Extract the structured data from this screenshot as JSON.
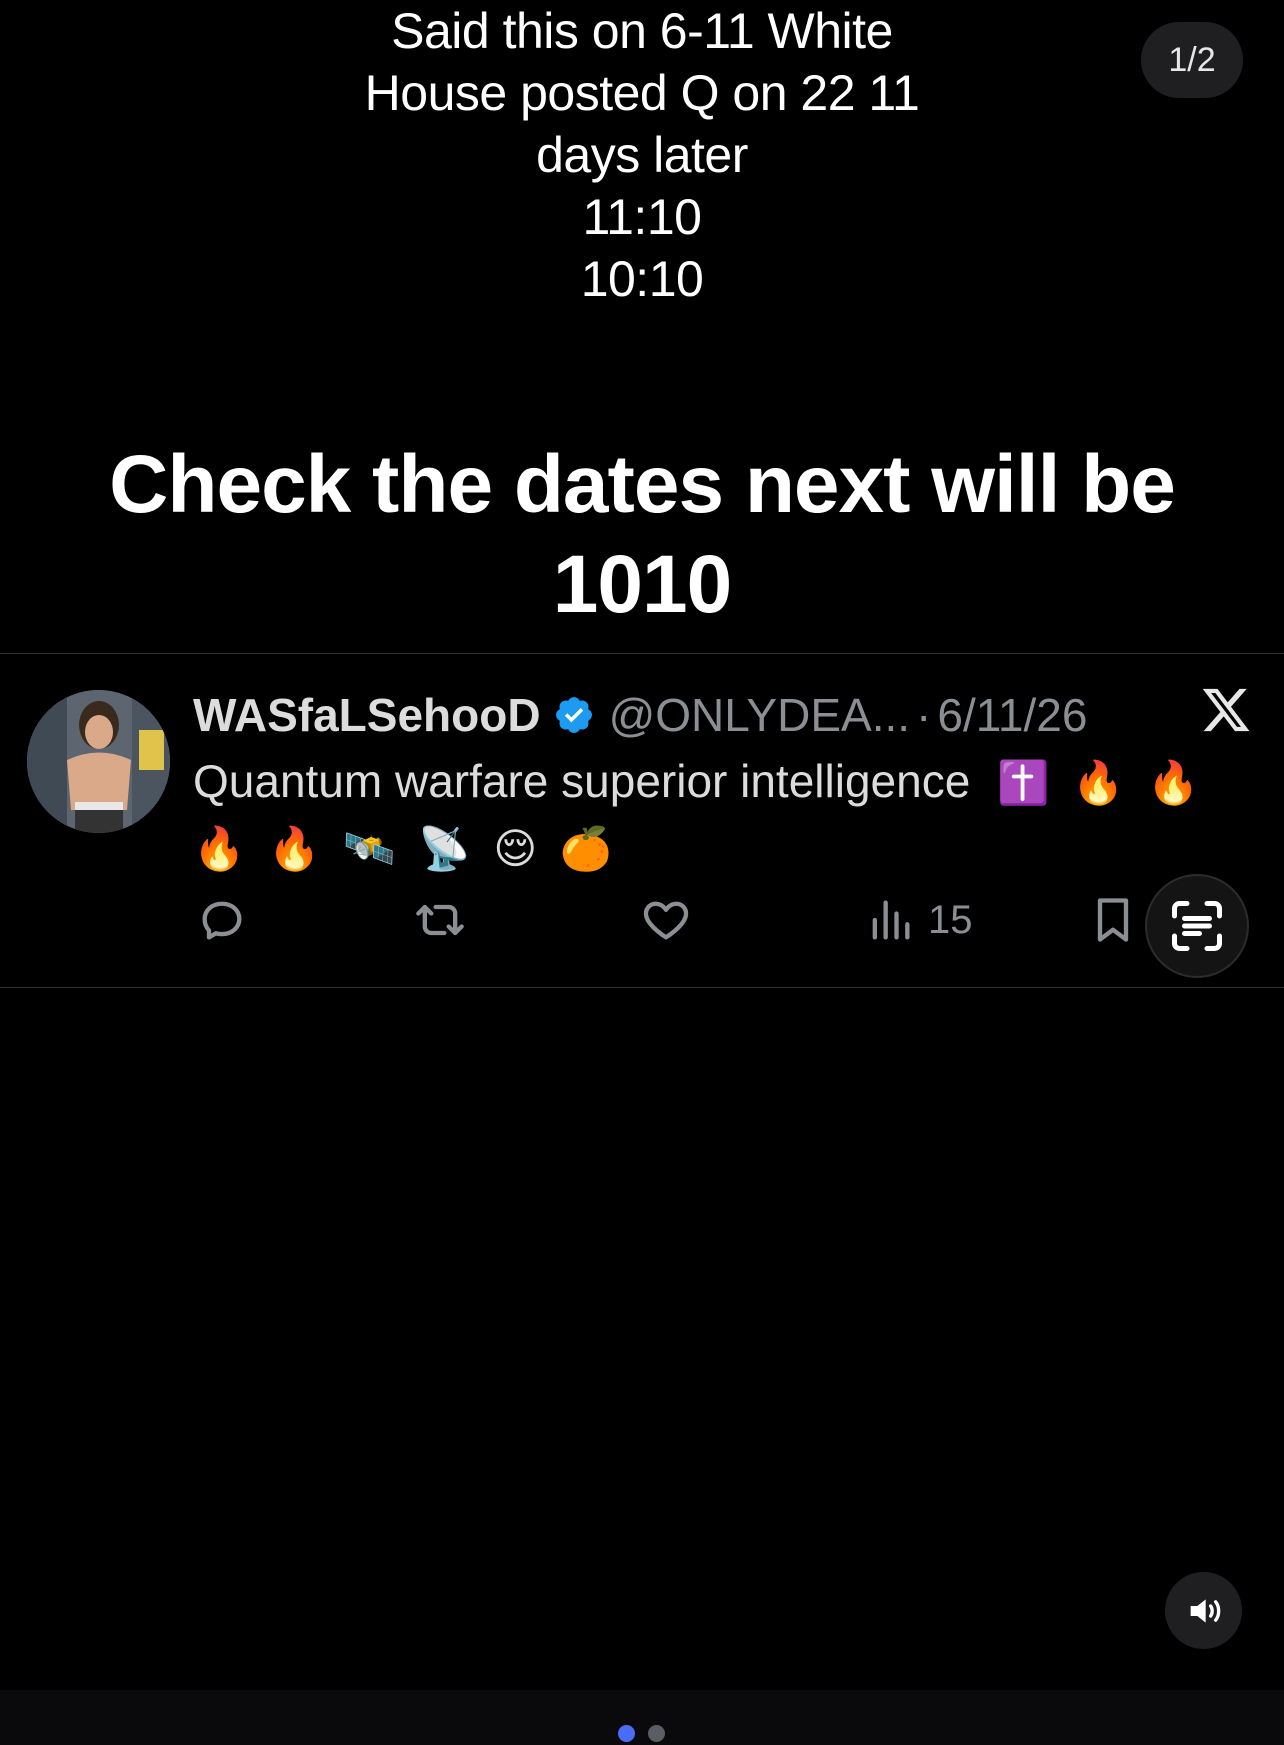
{
  "caption_top": {
    "lines": [
      "Said this on 6-11 White",
      "House posted Q on 22 11",
      "days later",
      "11:10",
      "10:10"
    ]
  },
  "page_indicator": "1/2",
  "caption_main": {
    "lines": [
      "Check the dates next will be",
      "1010"
    ]
  },
  "tweet": {
    "display_name": "WASfaLSehooD",
    "handle": "@ONLYDEA...",
    "separator": "·",
    "date": "6/11/26",
    "text_line1": "Quantum warfare superior intelligence",
    "emoji_line1": [
      "✝️",
      "🔥",
      "🔥"
    ],
    "emoji_line2": [
      "🔥",
      "🔥",
      "🛰️",
      "📡",
      "😌",
      "🍊"
    ],
    "views": "15",
    "icons": [
      "avatar",
      "verified-badge-icon",
      "x-logo-icon",
      "reply-icon",
      "retweet-icon",
      "like-icon",
      "views-icon",
      "bookmark-icon"
    ]
  },
  "overlay": {
    "scan_icon": "scan-text-icon",
    "sound_icon": "speaker-icon"
  },
  "pager": {
    "current": 1,
    "total": 2
  },
  "colors": {
    "background": "#000000",
    "secondary_text": "#8b8f94",
    "verified_blue": "#1d9bf0",
    "pager_active": "#4a6cf7",
    "pager_inactive": "#5a5d63"
  }
}
